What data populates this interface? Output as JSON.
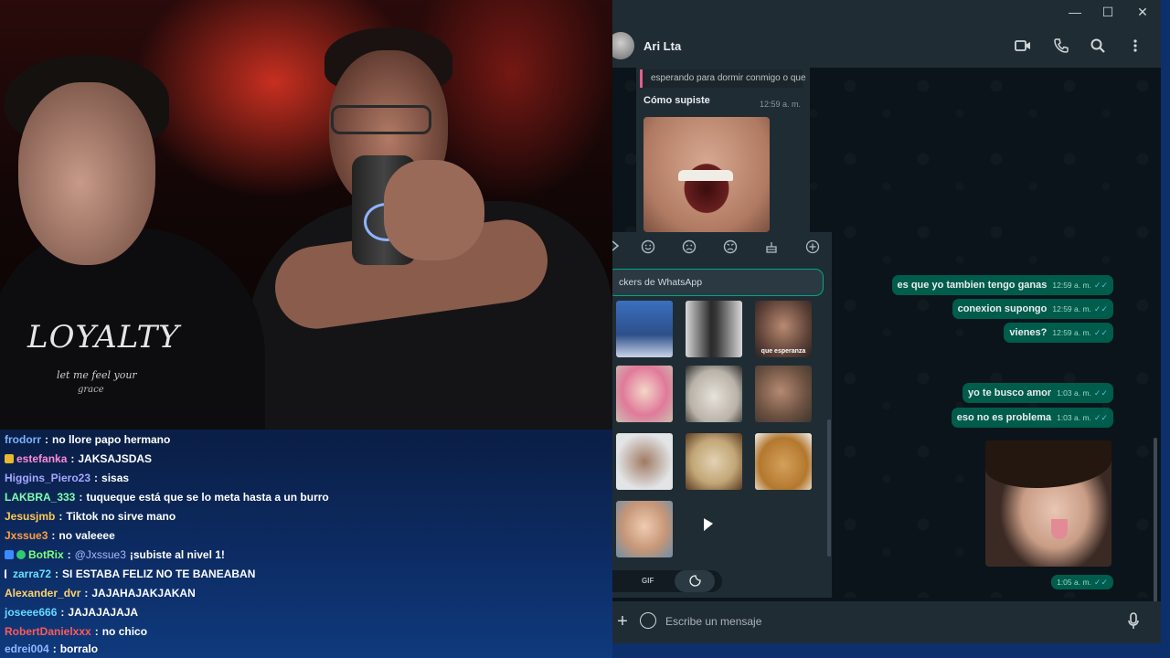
{
  "stream": {
    "shirt": {
      "logo": "LOYALTY",
      "line1": "let me feel your",
      "line2": "grace"
    }
  },
  "chat": {
    "lines": [
      {
        "user": "frodorr",
        "color": "#7ab3ff",
        "text": "no llore papo hermano"
      },
      {
        "user": "estefanka",
        "color": "#ff8ad8",
        "text": "JAKSAJSDAS"
      },
      {
        "user": "Higgins_Piero23",
        "color": "#a7a7ff",
        "text": "sisas"
      },
      {
        "user": "LAKBRA_333",
        "color": "#7dffb0",
        "text": "tuqueque está que se lo meta hasta a un burro"
      },
      {
        "user": "Jesusjmb",
        "color": "#ffc857",
        "text": "Tiktok no sirve mano"
      },
      {
        "user": "Jxssue3",
        "color": "#ff9f43",
        "text": "no valeeee"
      },
      {
        "user": "BotRix",
        "color": "#7dff7d",
        "mention": "@Jxssue3",
        "text": "¡subiste al nivel 1!"
      },
      {
        "user": "zarra72",
        "color": "#66e0ff",
        "text": "SI ESTABA FELIZ NO TE BANEABAN"
      },
      {
        "user": "Alexander_dvr",
        "color": "#ffd36b",
        "text": "JAJAHAJAKJAKAN"
      },
      {
        "user": "joseee666",
        "color": "#66d9ff",
        "text": "JAJAJAJAJA"
      },
      {
        "user": "RobertDanielxxx",
        "color": "#ff5a5a",
        "text": "no chico"
      },
      {
        "user": "edrei004",
        "color": "#8fb8ff",
        "text": "borralo"
      }
    ]
  },
  "window": {
    "minimize": "—",
    "maximize": "☐",
    "close": "✕"
  },
  "header": {
    "contact": "Ari Lta",
    "icons": [
      "video-call-icon",
      "voice-call-icon",
      "search-icon",
      "more-options-icon"
    ]
  },
  "incoming": {
    "quote": "esperando para dormir conmigo o que",
    "text": "Cómo supiste",
    "time": "12:59 a. m."
  },
  "outgoing": [
    {
      "text": "es que yo tambien tengo ganas",
      "time": "12:59 a. m."
    },
    {
      "text": "conexion supongo",
      "time": "12:59 a. m."
    },
    {
      "text": "vienes?",
      "time": "12:59 a. m."
    },
    {
      "text": "yo te busco amor",
      "time": "1:03 a. m."
    },
    {
      "text": "eso no es problema",
      "time": "1:03 a. m."
    }
  ],
  "image_message": {
    "time": "1:05 a. m."
  },
  "panel": {
    "categories": [
      "smile",
      "sad",
      "angry",
      "cake",
      "add"
    ],
    "search_placeholder": "ckers de WhatsApp",
    "sticker_caption": "que esperanza",
    "tab_gif": "GIF",
    "tab_sticker": "🗨"
  },
  "composer": {
    "plus": "+",
    "placeholder": "Escribe un mensaje"
  },
  "colors": {
    "accent": "#00a884",
    "outgoing_bubble": "#005c4b",
    "incoming_bubble": "#202c33",
    "read_tick": "#53bdeb"
  }
}
